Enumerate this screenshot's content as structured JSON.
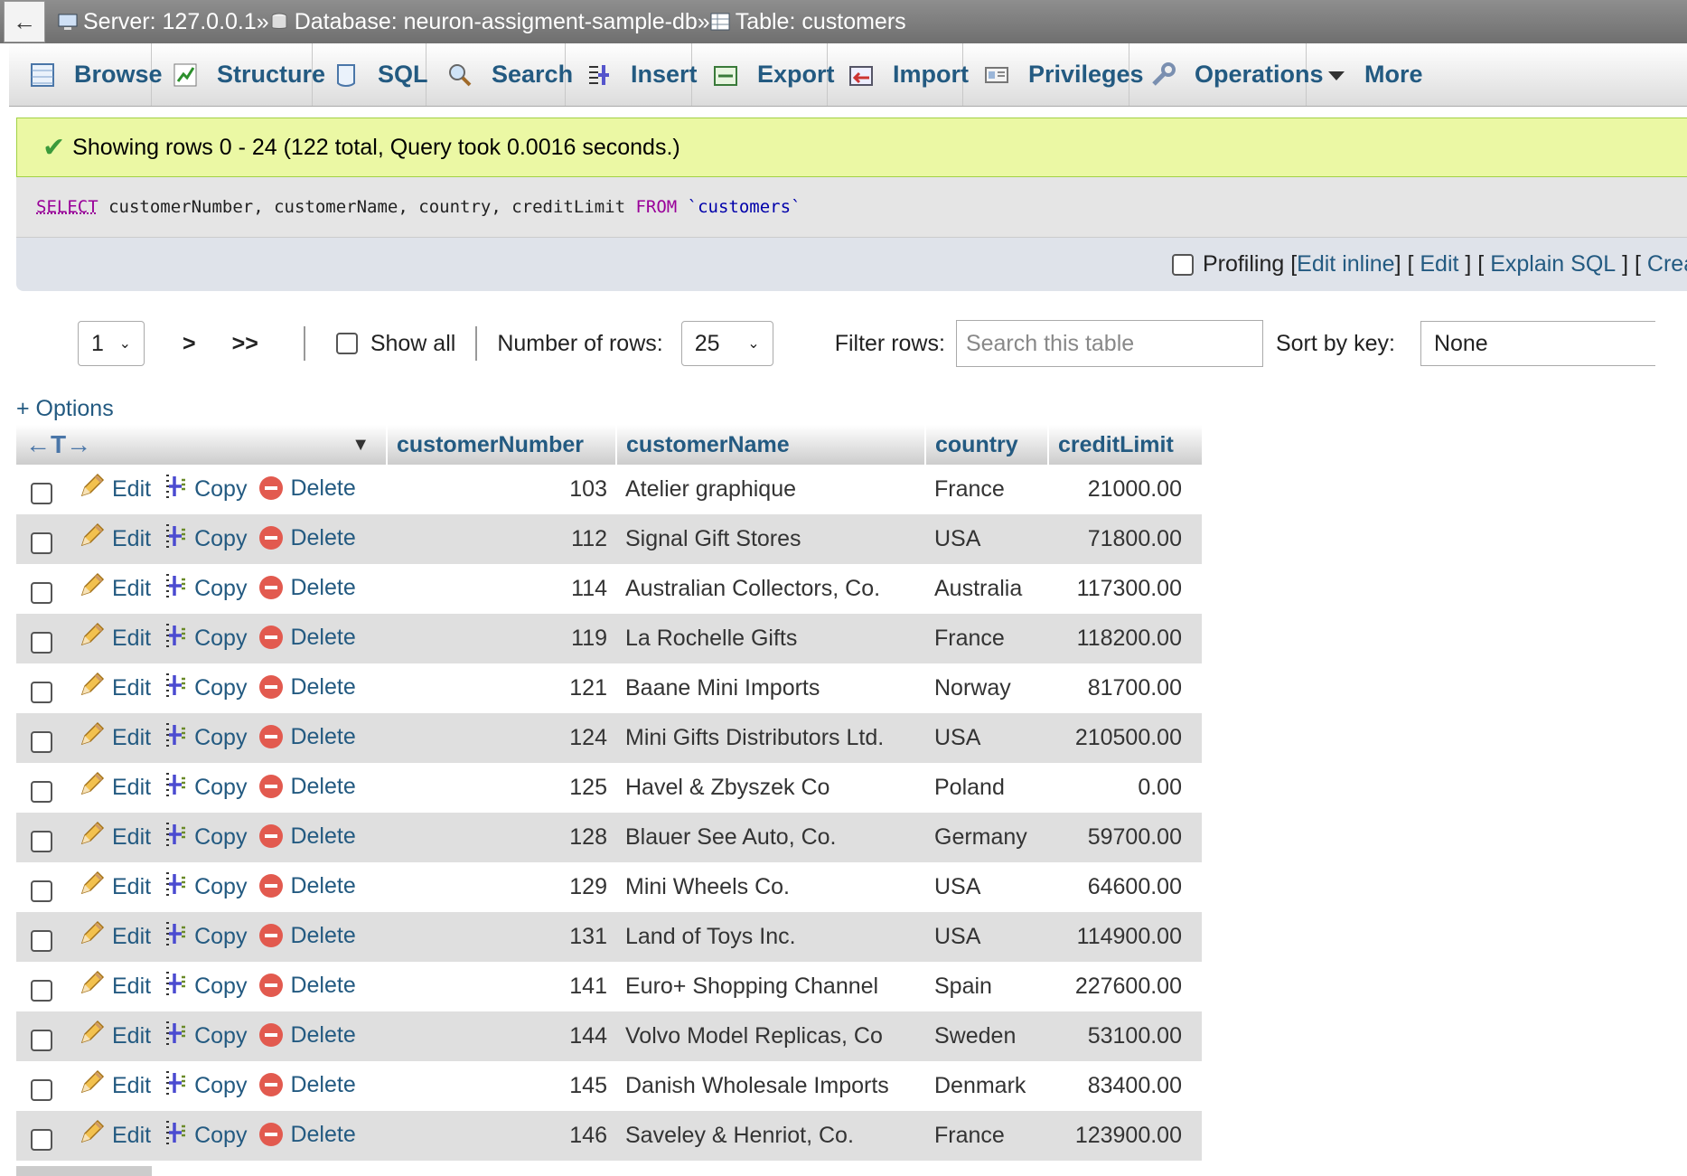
{
  "breadcrumb": {
    "back_label": "←",
    "server": "Server: 127.0.0.1",
    "database": "Database: neuron-assigment-sample-db",
    "table": "Table: customers",
    "separator": "»"
  },
  "tabs": [
    {
      "label": "Browse",
      "icon": "browse-icon"
    },
    {
      "label": "Structure",
      "icon": "structure-icon"
    },
    {
      "label": "SQL",
      "icon": "sql-icon"
    },
    {
      "label": "Search",
      "icon": "search-icon"
    },
    {
      "label": "Insert",
      "icon": "insert-icon"
    },
    {
      "label": "Export",
      "icon": "export-icon"
    },
    {
      "label": "Import",
      "icon": "import-icon"
    },
    {
      "label": "Privileges",
      "icon": "privileges-icon"
    },
    {
      "label": "Operations",
      "icon": "operations-icon"
    },
    {
      "label": "More",
      "icon": "dropdown-icon"
    }
  ],
  "message": "Showing rows 0 - 24 (122 total, Query took 0.0016 seconds.)",
  "sql": {
    "select_kw": "SELECT",
    "columns": " customerNumber, customerName, country, creditLimit ",
    "from_kw": "FROM",
    "table": " `customers`"
  },
  "tools": {
    "profiling": "Profiling",
    "edit_inline": "Edit inline",
    "edit": "Edit",
    "explain": "Explain SQL",
    "create_php": "Create PHP code"
  },
  "nav": {
    "page": "1",
    "next": ">",
    "last": ">>",
    "show_all": "Show all",
    "rows_label": "Number of rows:",
    "rows_value": "25",
    "filter_label": "Filter rows:",
    "filter_placeholder": "Search this table",
    "sort_label": "Sort by key:",
    "sort_value": "None"
  },
  "options_label": "+ Options",
  "table": {
    "columns": [
      "customerNumber",
      "customerName",
      "country",
      "creditLimit"
    ],
    "actions": {
      "edit": "Edit",
      "copy": "Copy",
      "delete": "Delete"
    },
    "rows": [
      [
        "103",
        "Atelier graphique",
        "France",
        "21000.00"
      ],
      [
        "112",
        "Signal Gift Stores",
        "USA",
        "71800.00"
      ],
      [
        "114",
        "Australian Collectors, Co.",
        "Australia",
        "117300.00"
      ],
      [
        "119",
        "La Rochelle Gifts",
        "France",
        "118200.00"
      ],
      [
        "121",
        "Baane Mini Imports",
        "Norway",
        "81700.00"
      ],
      [
        "124",
        "Mini Gifts Distributors Ltd.",
        "USA",
        "210500.00"
      ],
      [
        "125",
        "Havel & Zbyszek Co",
        "Poland",
        "0.00"
      ],
      [
        "128",
        "Blauer See Auto, Co.",
        "Germany",
        "59700.00"
      ],
      [
        "129",
        "Mini Wheels Co.",
        "USA",
        "64600.00"
      ],
      [
        "131",
        "Land of Toys Inc.",
        "USA",
        "114900.00"
      ],
      [
        "141",
        "Euro+ Shopping Channel",
        "Spain",
        "227600.00"
      ],
      [
        "144",
        "Volvo Model Replicas, Co",
        "Sweden",
        "53100.00"
      ],
      [
        "145",
        "Danish Wholesale Imports",
        "Denmark",
        "83400.00"
      ],
      [
        "146",
        "Saveley & Henriot, Co.",
        "France",
        "123900.00"
      ]
    ]
  },
  "colors": {
    "link": "#235a81",
    "success_bg": "#ebf8a4",
    "row_alt": "#dfdfdf",
    "delete": "#e25a4f"
  }
}
